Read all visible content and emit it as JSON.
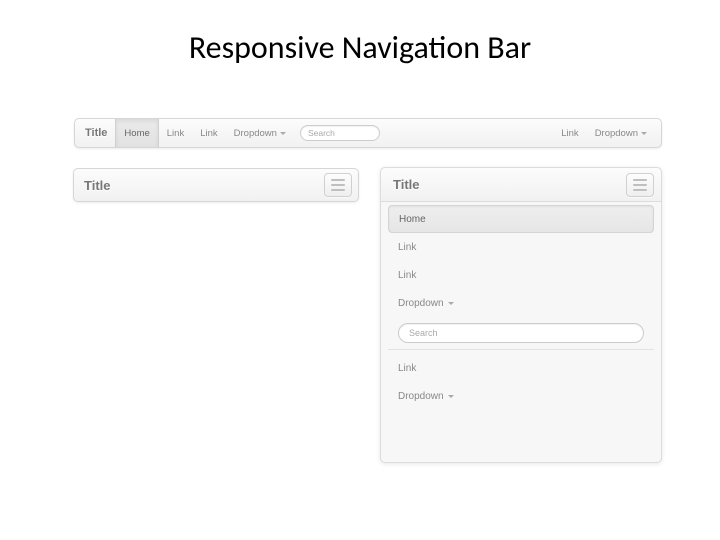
{
  "slide": {
    "title": "Responsive Navigation Bar"
  },
  "desktop": {
    "brand": "Title",
    "items_left": [
      {
        "label": "Home",
        "active": true
      },
      {
        "label": "Link",
        "active": false
      },
      {
        "label": "Link",
        "active": false
      },
      {
        "label": "Dropdown",
        "active": false,
        "caret": true
      }
    ],
    "search_placeholder": "Search",
    "items_right": [
      {
        "label": "Link",
        "active": false
      },
      {
        "label": "Dropdown",
        "active": false,
        "caret": true
      }
    ]
  },
  "collapsed": {
    "brand": "Title"
  },
  "expanded": {
    "brand": "Title",
    "rows_top": [
      {
        "label": "Home",
        "active": true
      },
      {
        "label": "Link",
        "active": false
      },
      {
        "label": "Link",
        "active": false
      },
      {
        "label": "Dropdown",
        "active": false,
        "caret": true
      }
    ],
    "search_placeholder": "Search",
    "rows_bottom": [
      {
        "label": "Link",
        "active": false
      },
      {
        "label": "Dropdown",
        "active": false,
        "caret": true
      }
    ]
  }
}
